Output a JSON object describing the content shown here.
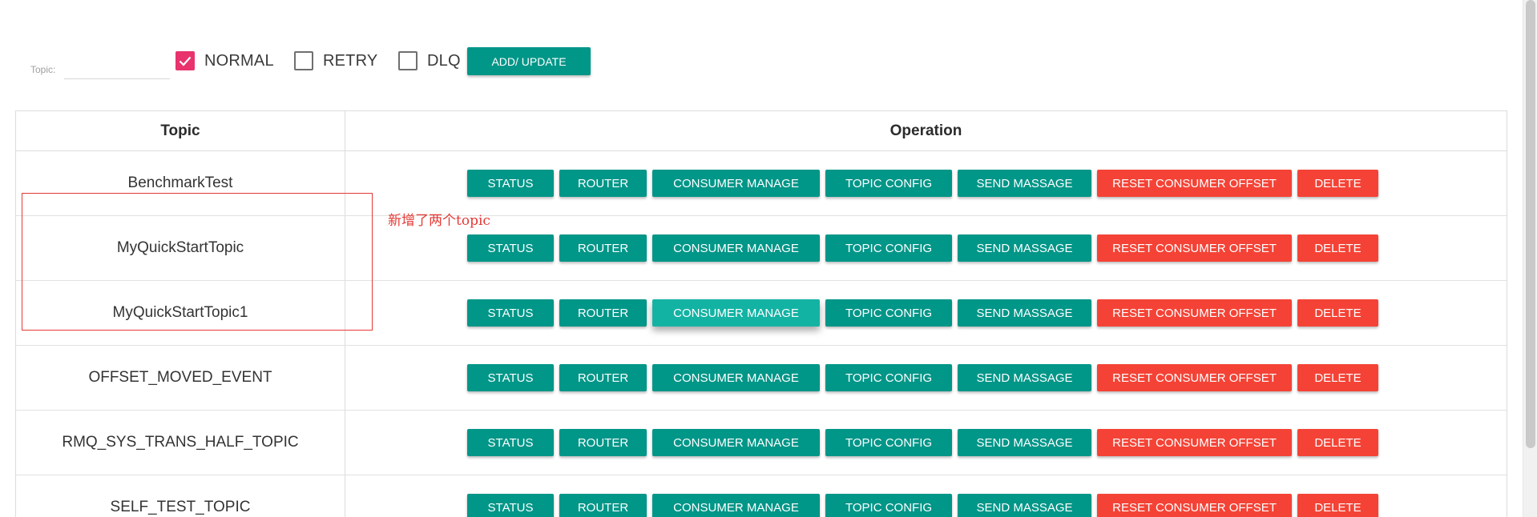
{
  "toolbar": {
    "topic_label": "Topic:",
    "topic_value": "",
    "checkboxes": [
      {
        "label": "NORMAL",
        "checked": true
      },
      {
        "label": "RETRY",
        "checked": false
      },
      {
        "label": "DLQ",
        "checked": false
      }
    ],
    "add_update_label": "ADD/ UPDATE"
  },
  "table": {
    "headers": {
      "topic": "Topic",
      "operation": "Operation"
    },
    "operations": [
      "STATUS",
      "ROUTER",
      "CONSUMER MANAGE",
      "TOPIC CONFIG",
      "SEND MASSAGE",
      "RESET CONSUMER OFFSET",
      "DELETE"
    ],
    "rows": [
      {
        "topic": "BenchmarkTest"
      },
      {
        "topic": "MyQuickStartTopic"
      },
      {
        "topic": "MyQuickStartTopic1"
      },
      {
        "topic": "OFFSET_MOVED_EVENT"
      },
      {
        "topic": "RMQ_SYS_TRANS_HALF_TOPIC"
      },
      {
        "topic": "SELF_TEST_TOPIC"
      }
    ]
  },
  "annotation": {
    "text": "新增了两个topic"
  },
  "colors": {
    "teal": "#009688",
    "red": "#f44336",
    "checkbox_pink": "#e8336d",
    "annotation_red": "#e53935"
  },
  "icons": {
    "checkbox_check": "check-icon"
  }
}
